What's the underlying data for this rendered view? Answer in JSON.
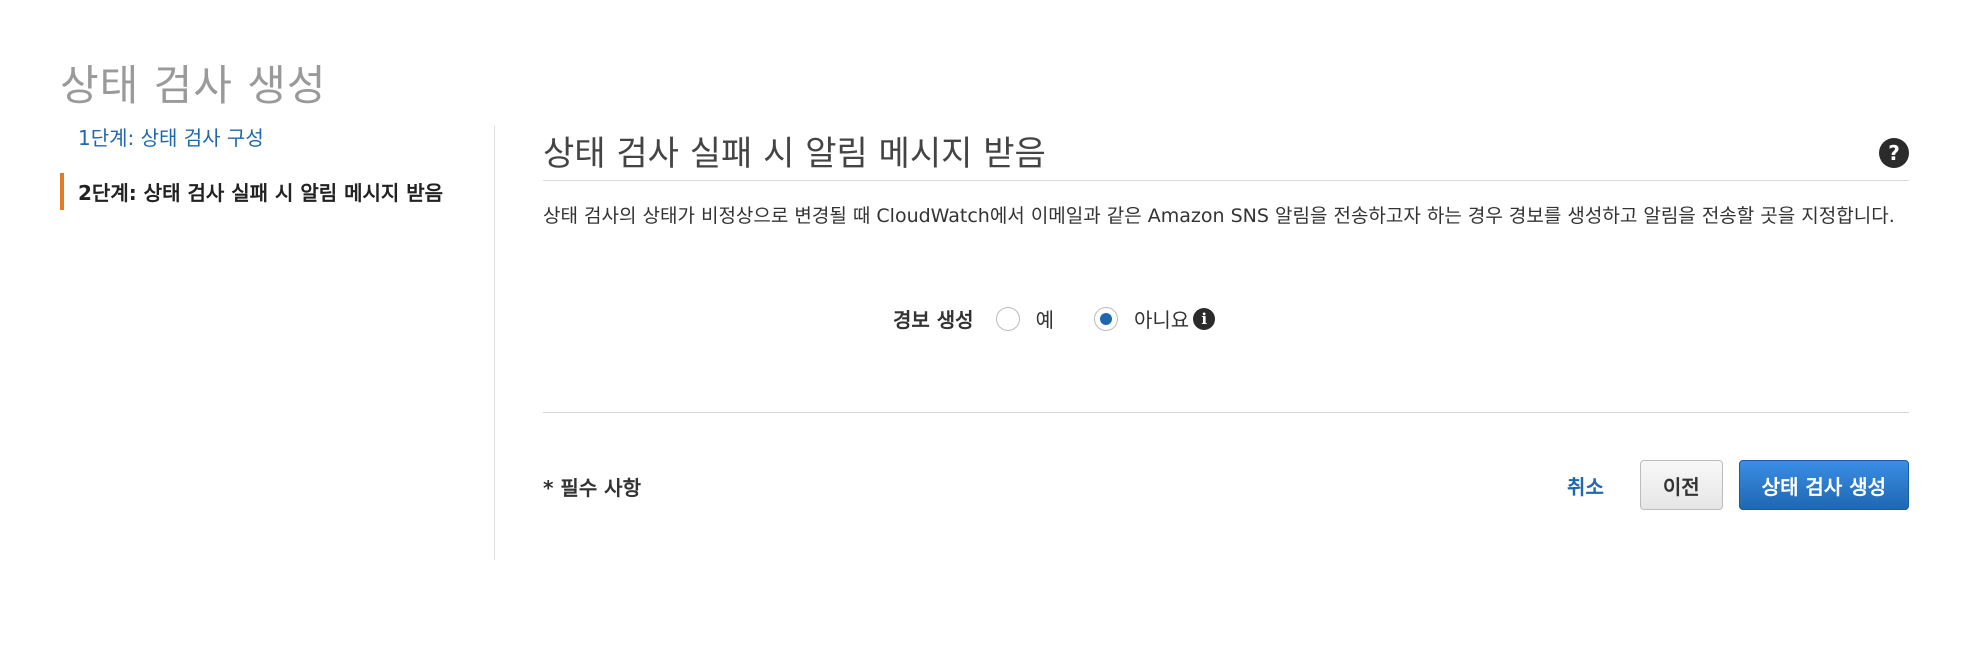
{
  "page": {
    "title": "상태 검사 생성"
  },
  "steps": [
    {
      "label": "1단계: 상태 검사 구성"
    },
    {
      "label": "2단계: 상태 검사 실패 시 알림 메시지 받음"
    }
  ],
  "section": {
    "title": "상태 검사 실패 시 알림 메시지 받음",
    "help_icon": "?",
    "description": "상태 검사의 상태가 비정상으로 변경될 때 CloudWatch에서 이메일과 같은 Amazon SNS 알림을 전송하고자 하는 경우 경보를 생성하고 알림을 전송할 곳을 지정합니다."
  },
  "alarm": {
    "label": "경보 생성",
    "options": [
      {
        "label": "예",
        "selected": false
      },
      {
        "label": "아니요",
        "selected": true
      }
    ],
    "info_icon": "i"
  },
  "footer": {
    "required_note": "* 필수 사항",
    "cancel_label": "취소",
    "previous_label": "이전",
    "create_label": "상태 검사 생성"
  },
  "colors": {
    "link": "#1f67b1",
    "current_step_marker": "#e07b27",
    "primary_button": "#1f67b1"
  }
}
